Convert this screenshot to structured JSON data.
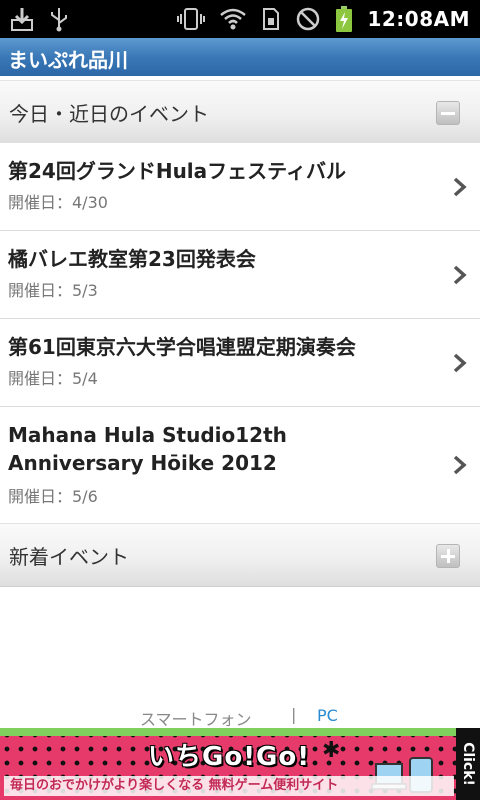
{
  "status_bar": {
    "time": "12:08AM",
    "icons": [
      "download-icon",
      "usb-icon",
      "vibrate-icon",
      "wifi-icon",
      "sim-icon",
      "no-signal-icon",
      "battery-charging-icon"
    ]
  },
  "app": {
    "title": "まいぷれ品川"
  },
  "sections": {
    "today": {
      "label": "今日・近日のイベント",
      "state": "expanded"
    },
    "new": {
      "label": "新着イベント",
      "state": "collapsed"
    }
  },
  "events": [
    {
      "title": "第24回グランドHulaフェスティバル",
      "date": "開催日：4/30"
    },
    {
      "title": "橘バレエ教室第23回発表会",
      "date": "開催日：5/3"
    },
    {
      "title": "第61回東京六大学合唱連盟定期演奏会",
      "date": "開催日：5/4"
    },
    {
      "title": "Mahana Hula Studio12th Anniversary Hōike 2012",
      "date": "開催日：5/6"
    }
  ],
  "footer": {
    "smartphone": "スマートフォン",
    "separator": "|",
    "pc": "PC"
  },
  "ad": {
    "logo": "いちGo!Go!",
    "tagline": "毎日のおでかけがより楽しくなる 無料ゲーム便利サイト",
    "click": "Click!"
  },
  "colors": {
    "title_bar": "#3a78b7",
    "pc_link": "#2a8bd1",
    "ad_background": "#e63b6a"
  }
}
